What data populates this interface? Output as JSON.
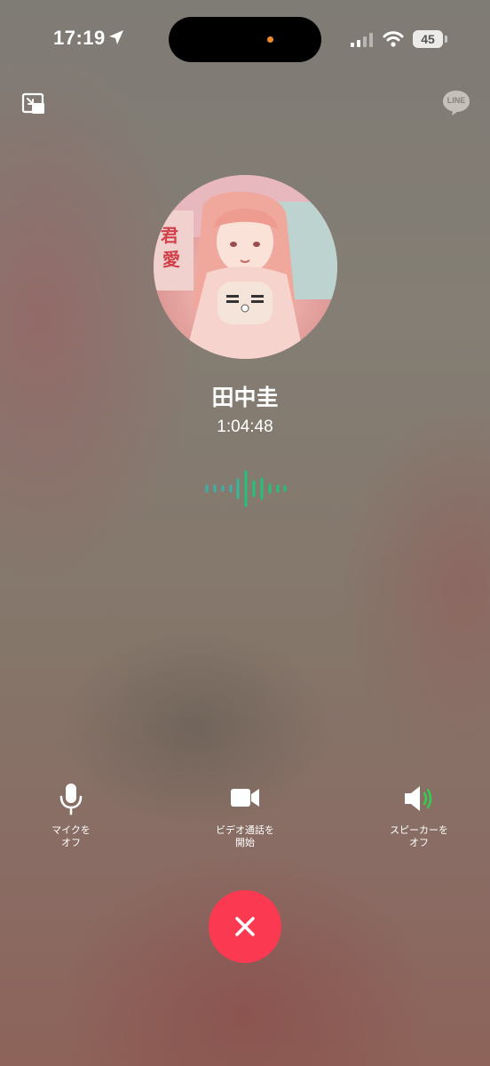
{
  "status_bar": {
    "time": "17:19",
    "battery": "45",
    "location_icon": "location-arrow-icon",
    "signal_icon": "cellular-signal-icon",
    "wifi_icon": "wifi-icon"
  },
  "header": {
    "minimize_icon": "picture-in-picture-icon",
    "logo_text": "LINE"
  },
  "call": {
    "contact_name": "田中圭",
    "duration": "1:04:48",
    "avatar_icon": "contact-avatar"
  },
  "controls": {
    "mic": {
      "label": "マイクを\nオフ",
      "icon": "microphone-icon"
    },
    "video": {
      "label": "ビデオ通話を\n開始",
      "icon": "video-camera-icon"
    },
    "speaker": {
      "label": "スピーカーを\nオフ",
      "icon": "speaker-icon",
      "active": true
    }
  },
  "end_call": {
    "icon": "close-icon"
  },
  "colors": {
    "end_call": "#fb3a52",
    "wave_teal": "#3bb0a8",
    "wave_green": "#23c27a",
    "speaker_active": "#2fd04c",
    "recording_dot": "#f08a2a"
  }
}
